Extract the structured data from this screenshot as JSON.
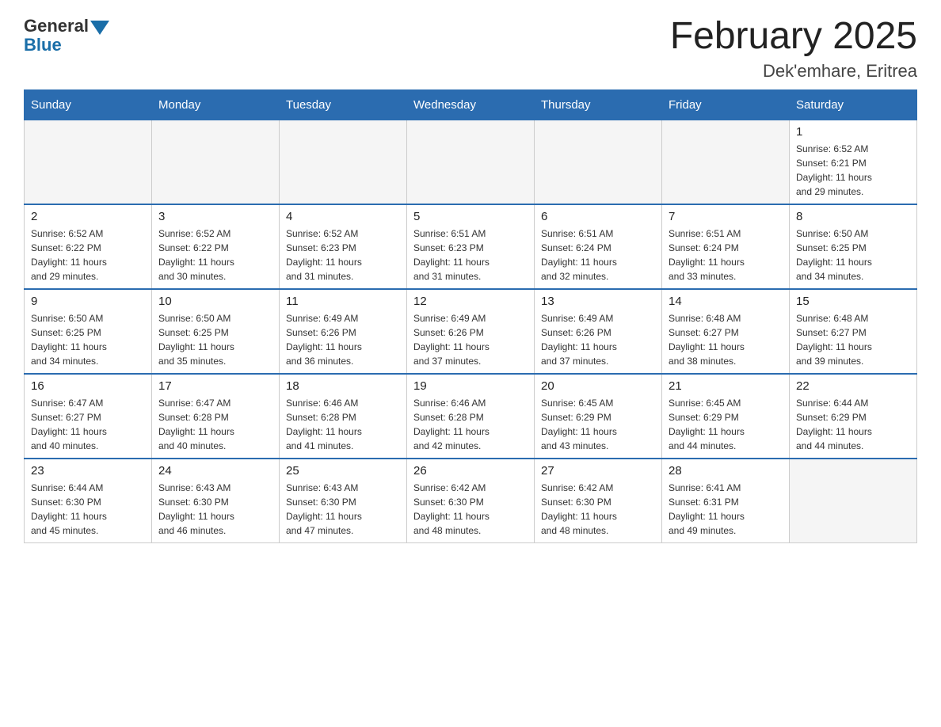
{
  "header": {
    "logo_general": "General",
    "logo_blue": "Blue",
    "title": "February 2025",
    "location": "Dek'emhare, Eritrea"
  },
  "days_of_week": [
    "Sunday",
    "Monday",
    "Tuesday",
    "Wednesday",
    "Thursday",
    "Friday",
    "Saturday"
  ],
  "weeks": [
    [
      {
        "day": "",
        "info": ""
      },
      {
        "day": "",
        "info": ""
      },
      {
        "day": "",
        "info": ""
      },
      {
        "day": "",
        "info": ""
      },
      {
        "day": "",
        "info": ""
      },
      {
        "day": "",
        "info": ""
      },
      {
        "day": "1",
        "info": "Sunrise: 6:52 AM\nSunset: 6:21 PM\nDaylight: 11 hours\nand 29 minutes."
      }
    ],
    [
      {
        "day": "2",
        "info": "Sunrise: 6:52 AM\nSunset: 6:22 PM\nDaylight: 11 hours\nand 29 minutes."
      },
      {
        "day": "3",
        "info": "Sunrise: 6:52 AM\nSunset: 6:22 PM\nDaylight: 11 hours\nand 30 minutes."
      },
      {
        "day": "4",
        "info": "Sunrise: 6:52 AM\nSunset: 6:23 PM\nDaylight: 11 hours\nand 31 minutes."
      },
      {
        "day": "5",
        "info": "Sunrise: 6:51 AM\nSunset: 6:23 PM\nDaylight: 11 hours\nand 31 minutes."
      },
      {
        "day": "6",
        "info": "Sunrise: 6:51 AM\nSunset: 6:24 PM\nDaylight: 11 hours\nand 32 minutes."
      },
      {
        "day": "7",
        "info": "Sunrise: 6:51 AM\nSunset: 6:24 PM\nDaylight: 11 hours\nand 33 minutes."
      },
      {
        "day": "8",
        "info": "Sunrise: 6:50 AM\nSunset: 6:25 PM\nDaylight: 11 hours\nand 34 minutes."
      }
    ],
    [
      {
        "day": "9",
        "info": "Sunrise: 6:50 AM\nSunset: 6:25 PM\nDaylight: 11 hours\nand 34 minutes."
      },
      {
        "day": "10",
        "info": "Sunrise: 6:50 AM\nSunset: 6:25 PM\nDaylight: 11 hours\nand 35 minutes."
      },
      {
        "day": "11",
        "info": "Sunrise: 6:49 AM\nSunset: 6:26 PM\nDaylight: 11 hours\nand 36 minutes."
      },
      {
        "day": "12",
        "info": "Sunrise: 6:49 AM\nSunset: 6:26 PM\nDaylight: 11 hours\nand 37 minutes."
      },
      {
        "day": "13",
        "info": "Sunrise: 6:49 AM\nSunset: 6:26 PM\nDaylight: 11 hours\nand 37 minutes."
      },
      {
        "day": "14",
        "info": "Sunrise: 6:48 AM\nSunset: 6:27 PM\nDaylight: 11 hours\nand 38 minutes."
      },
      {
        "day": "15",
        "info": "Sunrise: 6:48 AM\nSunset: 6:27 PM\nDaylight: 11 hours\nand 39 minutes."
      }
    ],
    [
      {
        "day": "16",
        "info": "Sunrise: 6:47 AM\nSunset: 6:27 PM\nDaylight: 11 hours\nand 40 minutes."
      },
      {
        "day": "17",
        "info": "Sunrise: 6:47 AM\nSunset: 6:28 PM\nDaylight: 11 hours\nand 40 minutes."
      },
      {
        "day": "18",
        "info": "Sunrise: 6:46 AM\nSunset: 6:28 PM\nDaylight: 11 hours\nand 41 minutes."
      },
      {
        "day": "19",
        "info": "Sunrise: 6:46 AM\nSunset: 6:28 PM\nDaylight: 11 hours\nand 42 minutes."
      },
      {
        "day": "20",
        "info": "Sunrise: 6:45 AM\nSunset: 6:29 PM\nDaylight: 11 hours\nand 43 minutes."
      },
      {
        "day": "21",
        "info": "Sunrise: 6:45 AM\nSunset: 6:29 PM\nDaylight: 11 hours\nand 44 minutes."
      },
      {
        "day": "22",
        "info": "Sunrise: 6:44 AM\nSunset: 6:29 PM\nDaylight: 11 hours\nand 44 minutes."
      }
    ],
    [
      {
        "day": "23",
        "info": "Sunrise: 6:44 AM\nSunset: 6:30 PM\nDaylight: 11 hours\nand 45 minutes."
      },
      {
        "day": "24",
        "info": "Sunrise: 6:43 AM\nSunset: 6:30 PM\nDaylight: 11 hours\nand 46 minutes."
      },
      {
        "day": "25",
        "info": "Sunrise: 6:43 AM\nSunset: 6:30 PM\nDaylight: 11 hours\nand 47 minutes."
      },
      {
        "day": "26",
        "info": "Sunrise: 6:42 AM\nSunset: 6:30 PM\nDaylight: 11 hours\nand 48 minutes."
      },
      {
        "day": "27",
        "info": "Sunrise: 6:42 AM\nSunset: 6:30 PM\nDaylight: 11 hours\nand 48 minutes."
      },
      {
        "day": "28",
        "info": "Sunrise: 6:41 AM\nSunset: 6:31 PM\nDaylight: 11 hours\nand 49 minutes."
      },
      {
        "day": "",
        "info": ""
      }
    ]
  ]
}
